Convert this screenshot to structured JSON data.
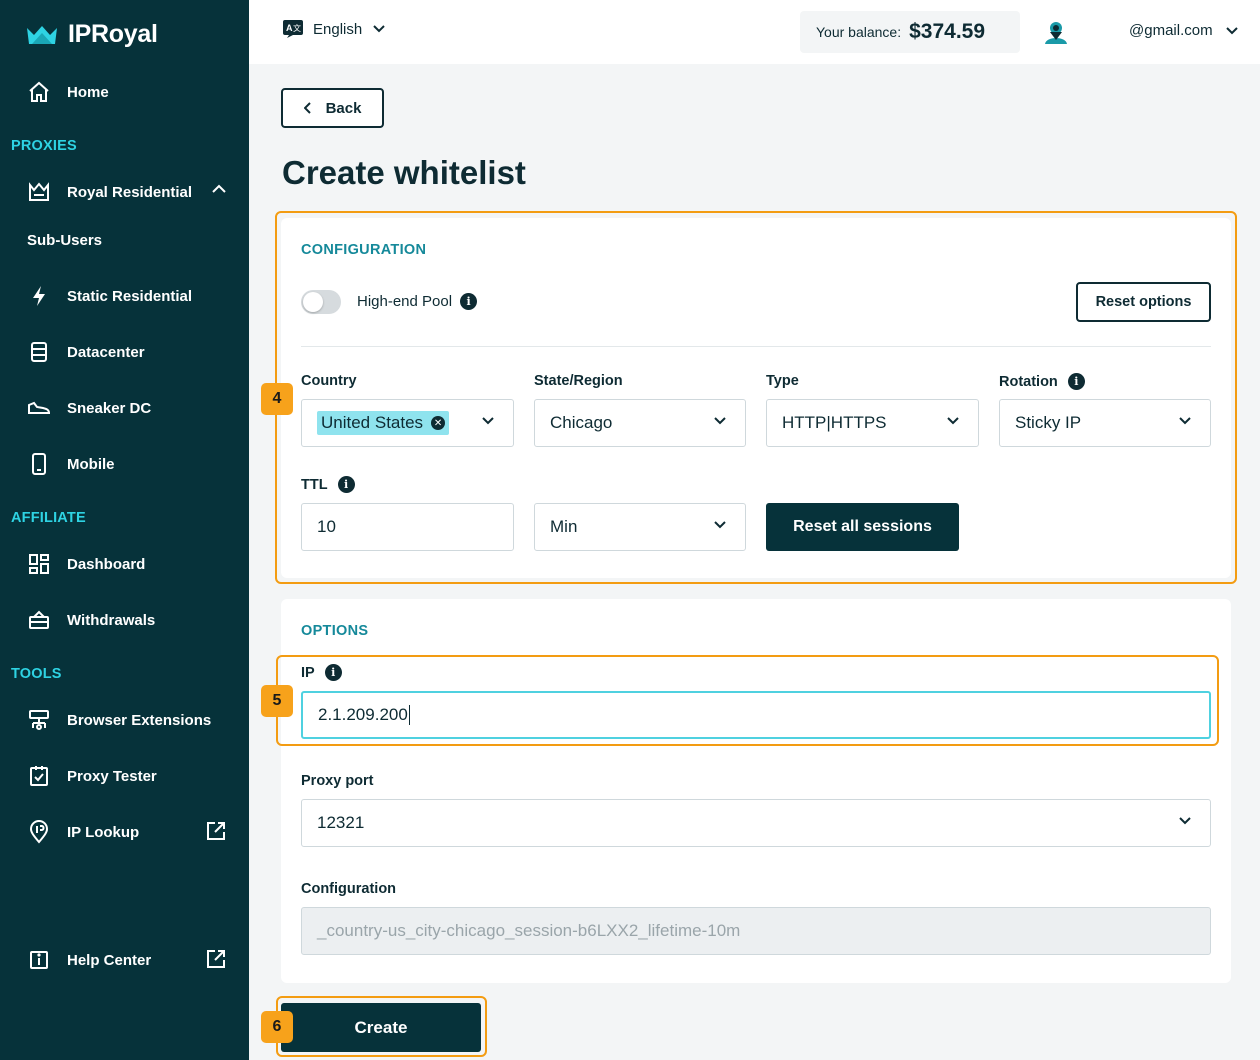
{
  "brand": {
    "name": "IPRoyal",
    "accent": "#2ed3e3",
    "sidebar_bg": "#06323a",
    "highlight": "#f39c12"
  },
  "sidebar": {
    "home": "Home",
    "proxies_title": "PROXIES",
    "royal_residential": "Royal Residential",
    "sub_users": "Sub-Users",
    "static_residential": "Static Residential",
    "datacenter": "Datacenter",
    "sneaker_dc": "Sneaker DC",
    "mobile": "Mobile",
    "affiliate_title": "AFFILIATE",
    "dashboard": "Dashboard",
    "withdrawals": "Withdrawals",
    "tools_title": "TOOLS",
    "browser_extensions": "Browser Extensions",
    "proxy_tester": "Proxy Tester",
    "ip_lookup": "IP Lookup",
    "help_center": "Help Center"
  },
  "topbar": {
    "language": "English",
    "balance_label": "Your balance:",
    "balance_amount": "$374.59",
    "email": "@gmail.com"
  },
  "main": {
    "back_label": "Back",
    "title": "Create whitelist",
    "configuration": {
      "title": "CONFIGURATION",
      "high_end_pool_label": "High-end Pool",
      "high_end_pool_on": false,
      "reset_options_label": "Reset options",
      "country_label": "Country",
      "country_value": "United States",
      "state_label": "State/Region",
      "state_value": "Chicago",
      "type_label": "Type",
      "type_value": "HTTP|HTTPS",
      "rotation_label": "Rotation",
      "rotation_value": "Sticky IP",
      "ttl_label": "TTL",
      "ttl_value": "10",
      "ttl_unit": "Min",
      "reset_sessions_label": "Reset all sessions"
    },
    "options": {
      "title": "OPTIONS",
      "ip_label": "IP",
      "ip_value": "2.1.209.200",
      "port_label": "Proxy port",
      "port_value": "12321",
      "config_label": "Configuration",
      "config_placeholder": "_country-us_city-chicago_session-b6LXX2_lifetime-10m"
    },
    "create_label": "Create"
  },
  "steps": {
    "config": "4",
    "ip": "5",
    "create": "6"
  }
}
